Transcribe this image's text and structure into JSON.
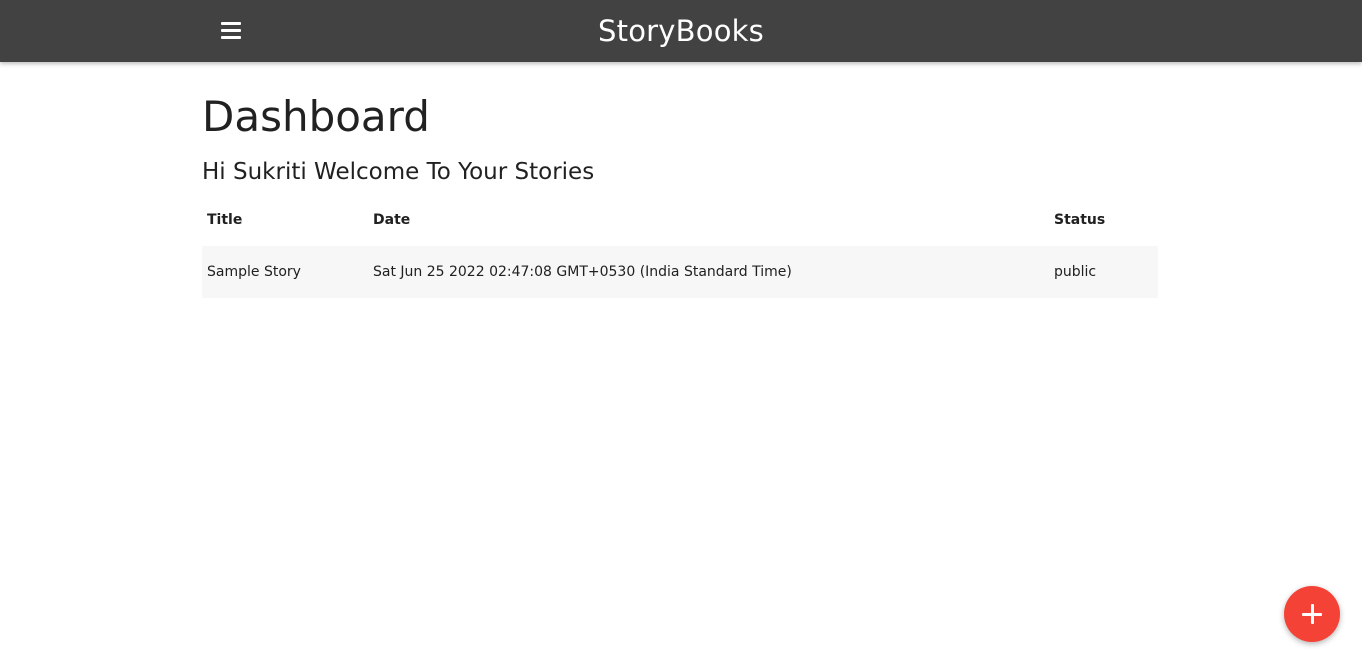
{
  "navbar": {
    "brand": "StoryBooks",
    "menu_icon": "hamburger-menu-icon"
  },
  "dashboard": {
    "title": "Dashboard",
    "welcome": "Hi Sukriti Welcome To Your Stories"
  },
  "table": {
    "headers": [
      "Title",
      "Date",
      "Status"
    ],
    "rows": [
      {
        "title": "Sample Story",
        "date": "Sat Jun 25 2022 02:47:08 GMT+0530 (India Standard Time)",
        "status": "public"
      }
    ]
  },
  "fab": {
    "icon": "plus-icon",
    "color": "#f44336"
  },
  "colors": {
    "navbar_bg": "#424242",
    "row_bg": "#f7f7f7",
    "accent": "#f44336"
  }
}
